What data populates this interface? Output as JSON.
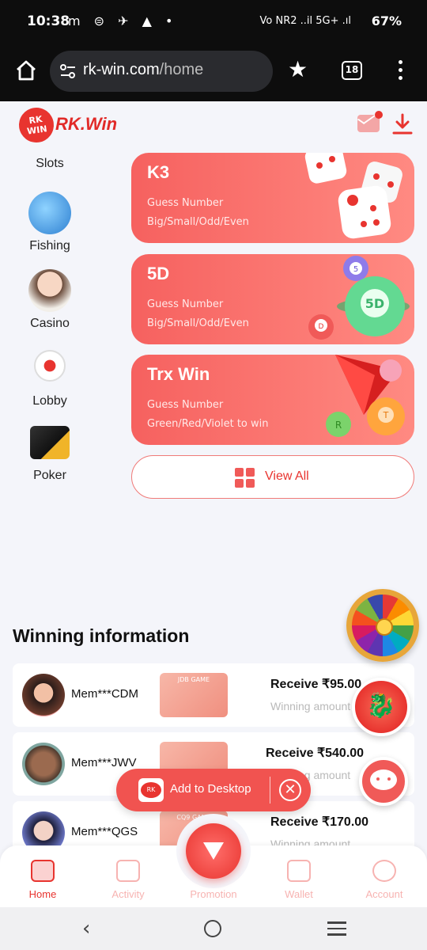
{
  "status_bar": {
    "time": "10:38",
    "left_icons": "m ⊜ ✈ ▲ •",
    "network": "Vo NR2 ..il 5G+ .ıl",
    "battery": "67%"
  },
  "browser": {
    "url_domain": "rk-win.com",
    "url_path": "/home",
    "tab_count": "18"
  },
  "app_header": {
    "logo_badge": "RK WIN",
    "logo_text": "RK.Win"
  },
  "categories": [
    {
      "label": "Slots",
      "icon": "slots-icon"
    },
    {
      "label": "Fishing",
      "icon": "shark-icon"
    },
    {
      "label": "Casino",
      "icon": "dealer-icon"
    },
    {
      "label": "Lobby",
      "icon": "football-icon"
    },
    {
      "label": "Poker",
      "icon": "cards-icon"
    }
  ],
  "games": [
    {
      "title": "K3",
      "line1": "Guess Number",
      "line2": "Big/Small/Odd/Even",
      "art": "dice-icon"
    },
    {
      "title": "5D",
      "line1": "Guess Number",
      "line2": "Big/Small/Odd/Even",
      "art": "lottery-ball-icon"
    },
    {
      "title": "Trx Win",
      "line1": "Guess Number",
      "line2": "Green/Red/Violet to win",
      "art": "trx-icon"
    }
  ],
  "view_all_label": "View All",
  "winning": {
    "title": "Winning information",
    "rows": [
      {
        "member": "Mem***CDM",
        "game_tag": "JDB GAME",
        "receive": "Receive ₹95.00",
        "sub": "Winning amount"
      },
      {
        "member": "Mem***JWV",
        "game_tag": "",
        "receive": "Receive ₹540.00",
        "sub": "Winning amount"
      },
      {
        "member": "Mem***QGS",
        "game_tag": "CQ9 GAME",
        "receive": "Receive ₹170.00",
        "sub": "Winning amount"
      }
    ]
  },
  "add_desktop": {
    "label": "Add to Desktop"
  },
  "bottom_nav": [
    {
      "label": "Home",
      "active": true
    },
    {
      "label": "Activity",
      "active": false
    },
    {
      "label": "Promotion",
      "active": false
    },
    {
      "label": "Wallet",
      "active": false
    },
    {
      "label": "Account",
      "active": false
    }
  ],
  "colors": {
    "accent": "#e8342f",
    "card_gradient_start": "#f6615f",
    "card_gradient_end": "#ff8a82",
    "background": "#f4f5fa"
  }
}
